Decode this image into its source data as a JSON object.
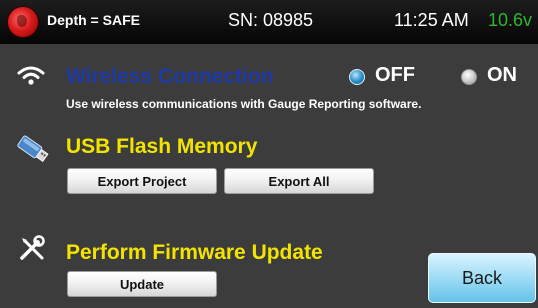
{
  "status_bar": {
    "depth_label": "Depth = SAFE",
    "serial": "SN: 08985",
    "time": "11:25 AM",
    "battery": "10.6v"
  },
  "wireless": {
    "title": "Wireless Connection",
    "description": "Use wireless communications with Gauge Reporting software.",
    "options": [
      {
        "label": "OFF",
        "selected": true
      },
      {
        "label": "ON",
        "selected": false
      }
    ]
  },
  "usb": {
    "title": "USB Flash Memory",
    "buttons": {
      "export_project": "Export Project",
      "export_all": "Export All"
    }
  },
  "firmware": {
    "title": "Perform Firmware Update",
    "button": "Update"
  },
  "back_button": "Back",
  "colors": {
    "background": "#3c3c3c",
    "section_title": "#f2e400",
    "disabled_title": "#1e3aa8",
    "battery_text": "#2fb52f",
    "back_button": "#9edcf5"
  },
  "icons": [
    "logo-icon",
    "wifi-icon",
    "usb-drive-icon",
    "tools-icon",
    "radio-icon"
  ]
}
